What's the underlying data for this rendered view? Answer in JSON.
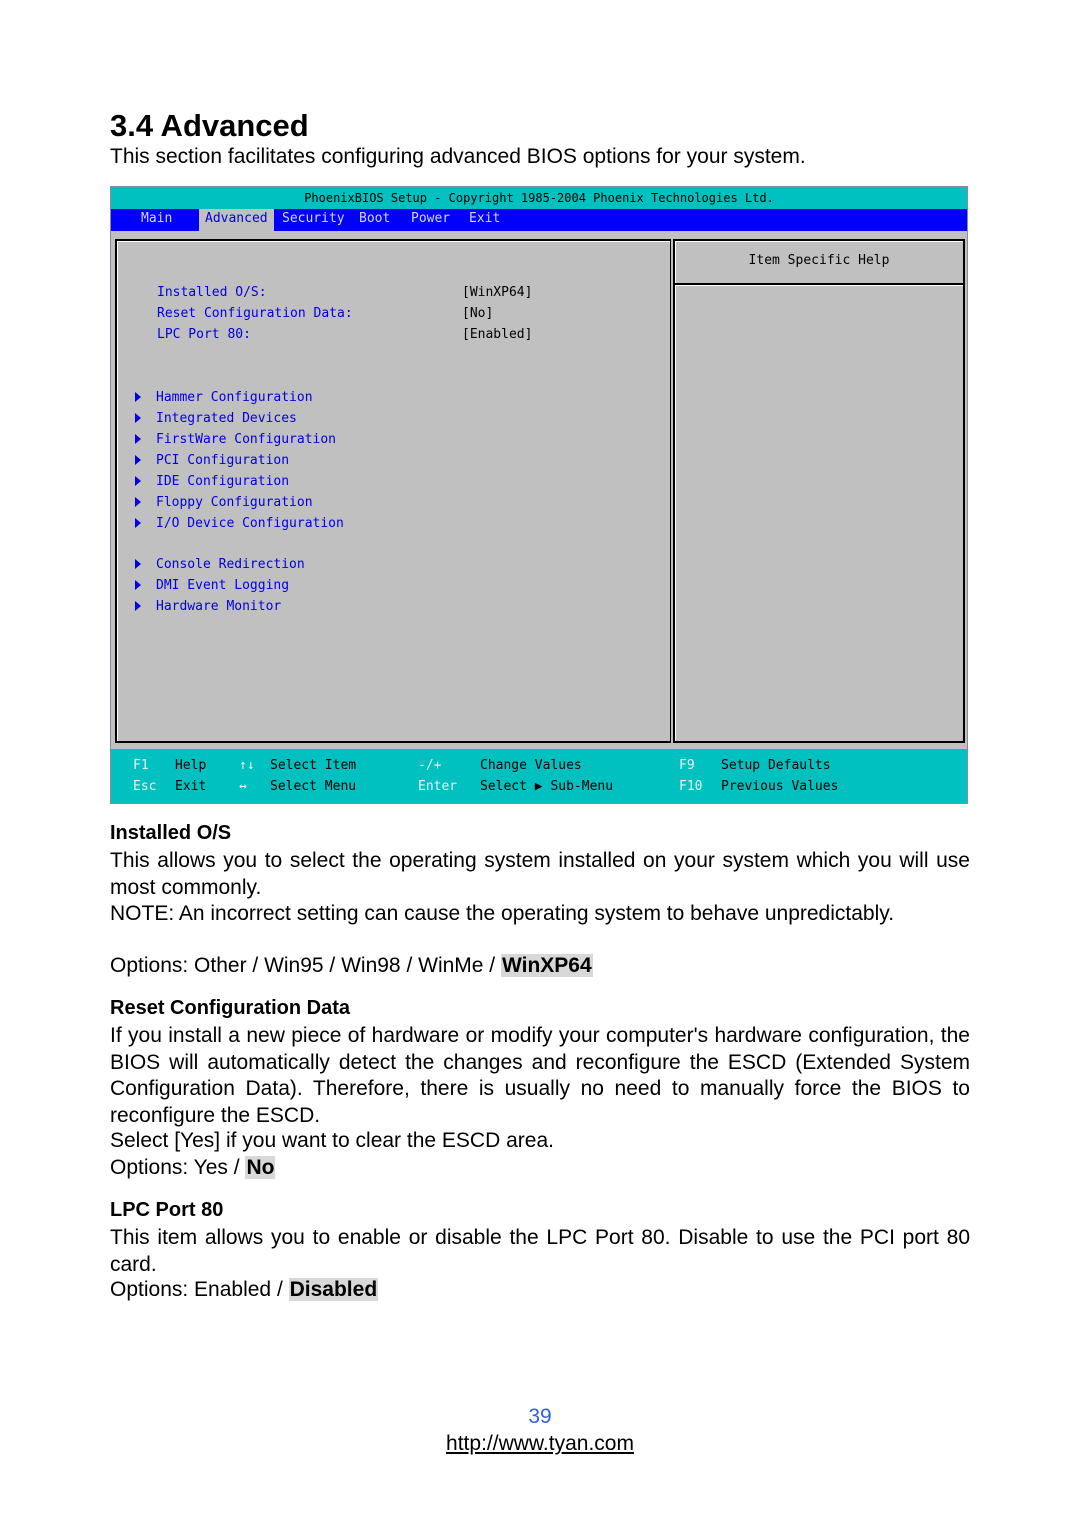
{
  "section": {
    "title": "3.4 Advanced",
    "intro": "This section facilitates configuring advanced BIOS options for your system."
  },
  "bios": {
    "title_bar": "PhoenixBIOS Setup - Copyright 1985-2004 Phoenix Technologies Ltd.",
    "tabs": [
      {
        "label": "Main",
        "active": false
      },
      {
        "label": "Advanced",
        "active": true
      },
      {
        "label": "Security",
        "active": false
      },
      {
        "label": "Boot",
        "active": false
      },
      {
        "label": "Power",
        "active": false
      },
      {
        "label": "Exit",
        "active": false
      }
    ],
    "settings": [
      {
        "label": "Installed O/S:",
        "value": "[WinXP64]"
      },
      {
        "label": "Reset Configuration Data:",
        "value": "[No]"
      },
      {
        "label": "LPC Port 80:",
        "value": "[Enabled]"
      }
    ],
    "submenus": [
      "Hammer Configuration",
      "Integrated Devices",
      "FirstWare Configuration",
      "PCI Configuration",
      "IDE Configuration",
      "Floppy Configuration",
      "I/O Device Configuration",
      "Console Redirection",
      "DMI Event Logging",
      "Hardware Monitor"
    ],
    "help_title": "Item Specific Help",
    "footer": [
      {
        "key": "F1",
        "desc": "Help"
      },
      {
        "key": "Esc",
        "desc": "Exit"
      },
      {
        "key": "↑↓",
        "desc": "Select Item"
      },
      {
        "key": "↔",
        "desc": "Select Menu"
      },
      {
        "key": "-/+",
        "desc": "Change Values"
      },
      {
        "key": "Enter",
        "desc": "Select ▶ Sub-Menu"
      },
      {
        "key": "F9",
        "desc": "Setup Defaults"
      },
      {
        "key": "F10",
        "desc": "Previous Values"
      }
    ]
  },
  "installed_os": {
    "heading": "Installed O/S",
    "description": "This allows you to select the operating system installed on your system which you will use most commonly.",
    "note": "NOTE: An incorrect setting can cause the operating system to behave unpredictably.",
    "options_prefix": "Options: Other / Win95 / Win98 / WinMe / ",
    "default_option": "WinXP64"
  },
  "reset_config": {
    "heading": "Reset Configuration Data",
    "description": "If you install a new piece of hardware or modify your computer's hardware configuration, the BIOS will automatically detect the changes and reconfigure the ESCD (Extended System Configuration Data). Therefore, there is usually no need to manually force the BIOS to reconfigure the ESCD.",
    "select_note": "Select [Yes] if you want to clear the ESCD area.",
    "options_prefix": "Options: Yes / ",
    "default_option": "No"
  },
  "lpc_port": {
    "heading": "LPC Port 80",
    "description": "This item allows you to enable or disable the LPC Port 80.  Disable to use the PCI port 80 card.",
    "options_prefix": "Options: Enabled / ",
    "default_option": "Disabled"
  },
  "footer": {
    "page_number": "39",
    "link": "http://www.tyan.com"
  }
}
